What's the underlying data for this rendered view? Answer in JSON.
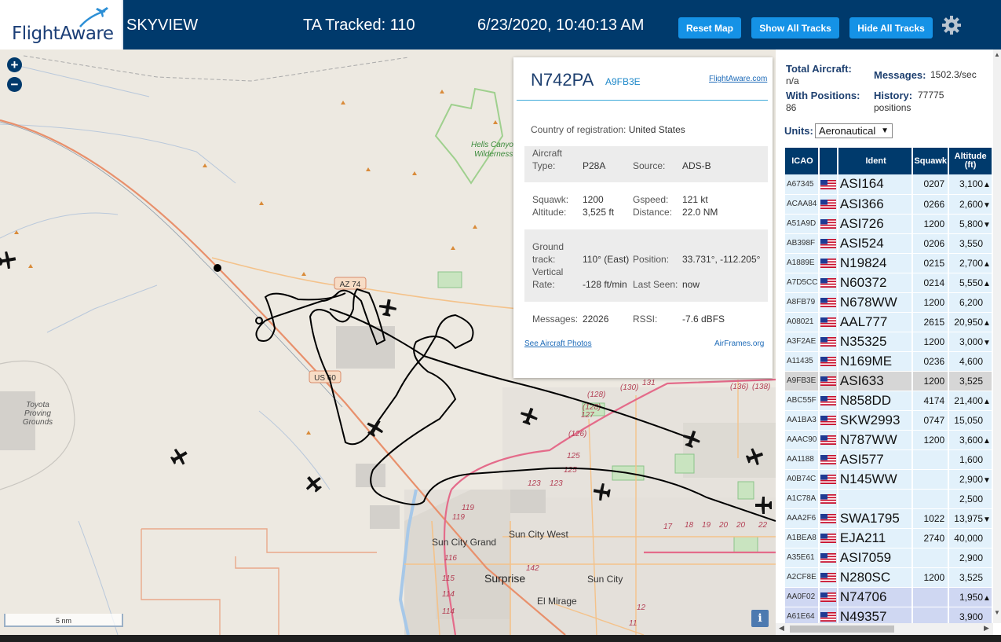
{
  "header": {
    "logo_text": "FlightAware",
    "app_name": "SKYVIEW",
    "tracked": "TA Tracked: 110",
    "datetime": "6/23/2020, 10:40:13 AM",
    "reset_label": "Reset Map",
    "show_all_label": "Show All Tracks",
    "hide_all_label": "Hide All Tracks",
    "settings_icon": "gear-icon"
  },
  "map": {
    "zoom_in": "+",
    "zoom_out": "−",
    "scale": "5 nm",
    "info": "i",
    "labels": {
      "hells_canyon": "Hells Canyon",
      "wilderness": "Wilderness",
      "toyota1": "Toyota",
      "toyota2": "Proving",
      "toyota3": "Grounds",
      "az74": "AZ 74",
      "us60": "US 60",
      "sun_city_grand": "Sun City Grand",
      "sun_city_west": "Sun City West",
      "surprise": "Surprise",
      "sun_city": "Sun City",
      "el_mirage": "El Mirage"
    }
  },
  "popup": {
    "registration": "N742PA",
    "hex": "A9FB3E",
    "fa_link": "FlightAware.com",
    "country_label": "Country of registration:",
    "country": "United States",
    "aircraft_type_label": "Aircraft",
    "type_label": "Type:",
    "type": "P28A",
    "source_label": "Source:",
    "source": "ADS-B",
    "squawk_label": "Squawk:",
    "squawk": "1200",
    "gspeed_label": "Gspeed:",
    "gspeed": "121 kt",
    "altitude_label": "Altitude:",
    "altitude": "3,525 ft",
    "distance_label": "Distance:",
    "distance": "22.0 NM",
    "ground_label": "Ground",
    "track_label": "track:",
    "track": "110° (East)",
    "position_label": "Position:",
    "position": "33.731°, -112.205°",
    "vertical_label": "Vertical",
    "rate_label": "Rate:",
    "rate": "-128 ft/min",
    "last_seen_label": "Last Seen:",
    "last_seen": "now",
    "messages_label": "Messages:",
    "messages": "22026",
    "rssi_label": "RSSI:",
    "rssi": "-7.6 dBFS",
    "photos_link": "See Aircraft Photos",
    "airframes_link": "AirFrames.org"
  },
  "stats": {
    "total_label": "Total Aircraft:",
    "total": "n/a",
    "messages_label": "Messages:",
    "messages": "1502.3/sec",
    "positions_label": "With Positions:",
    "positions": "86",
    "history_label": "History:",
    "history": "77775",
    "history_unit": "positions",
    "units_label": "Units:",
    "units_value": "Aeronautical"
  },
  "table": {
    "headers": [
      "ICAO",
      "",
      "Ident",
      "Squawk",
      "Altitude (ft)"
    ],
    "rows": [
      {
        "icao": "A67345",
        "ident": "ASI164",
        "squawk": "0207",
        "altitude": "3,100",
        "trend": "▲",
        "state": ""
      },
      {
        "icao": "ACAA84",
        "ident": "ASI366",
        "squawk": "0266",
        "altitude": "2,600",
        "trend": "▼",
        "state": ""
      },
      {
        "icao": "A51A9D",
        "ident": "ASI726",
        "squawk": "1200",
        "altitude": "5,800",
        "trend": "▼",
        "state": ""
      },
      {
        "icao": "AB398F",
        "ident": "ASI524",
        "squawk": "0206",
        "altitude": "3,550",
        "trend": "",
        "state": ""
      },
      {
        "icao": "A1889E",
        "ident": "N19824",
        "squawk": "0215",
        "altitude": "2,700",
        "trend": "▲",
        "state": ""
      },
      {
        "icao": "A7D5CC",
        "ident": "N60372",
        "squawk": "0214",
        "altitude": "5,550",
        "trend": "▲",
        "state": ""
      },
      {
        "icao": "A8FB79",
        "ident": "N678WW",
        "squawk": "1200",
        "altitude": "6,200",
        "trend": "",
        "state": ""
      },
      {
        "icao": "A08021",
        "ident": "AAL777",
        "squawk": "2615",
        "altitude": "20,950",
        "trend": "▲",
        "state": ""
      },
      {
        "icao": "A3F2AE",
        "ident": "N35325",
        "squawk": "1200",
        "altitude": "3,000",
        "trend": "▼",
        "state": ""
      },
      {
        "icao": "A11435",
        "ident": "N169ME",
        "squawk": "0236",
        "altitude": "4,600",
        "trend": "",
        "state": ""
      },
      {
        "icao": "A9FB3E",
        "ident": "ASI633",
        "squawk": "1200",
        "altitude": "3,525",
        "trend": "",
        "state": "selected"
      },
      {
        "icao": "ABC55F",
        "ident": "N858DD",
        "squawk": "4174",
        "altitude": "21,400",
        "trend": "▲",
        "state": ""
      },
      {
        "icao": "AA1BA3",
        "ident": "SKW2993",
        "squawk": "0747",
        "altitude": "15,050",
        "trend": "",
        "state": ""
      },
      {
        "icao": "AAAC90",
        "ident": "N787WW",
        "squawk": "1200",
        "altitude": "3,600",
        "trend": "▲",
        "state": ""
      },
      {
        "icao": "AA1188",
        "ident": "ASI577",
        "squawk": "",
        "altitude": "1,600",
        "trend": "",
        "state": ""
      },
      {
        "icao": "A0B74C",
        "ident": "N145WW",
        "squawk": "",
        "altitude": "2,900",
        "trend": "▼",
        "state": ""
      },
      {
        "icao": "A1C78A",
        "ident": "",
        "squawk": "",
        "altitude": "2,500",
        "trend": "",
        "state": ""
      },
      {
        "icao": "AAA2F6",
        "ident": "SWA1795",
        "squawk": "1022",
        "altitude": "13,975",
        "trend": "▼",
        "state": ""
      },
      {
        "icao": "A1BEA8",
        "ident": "EJA211",
        "squawk": "2740",
        "altitude": "40,000",
        "trend": "",
        "state": ""
      },
      {
        "icao": "A35E61",
        "ident": "ASI7059",
        "squawk": "",
        "altitude": "2,900",
        "trend": "",
        "state": ""
      },
      {
        "icao": "A2CF8E",
        "ident": "N280SC",
        "squawk": "1200",
        "altitude": "3,525",
        "trend": "",
        "state": ""
      },
      {
        "icao": "AA0F02",
        "ident": "N74706",
        "squawk": "",
        "altitude": "1,950",
        "trend": "▲",
        "state": "hist"
      },
      {
        "icao": "A61E64",
        "ident": "N49357",
        "squawk": "",
        "altitude": "3,900",
        "trend": "",
        "state": "hist"
      }
    ]
  }
}
